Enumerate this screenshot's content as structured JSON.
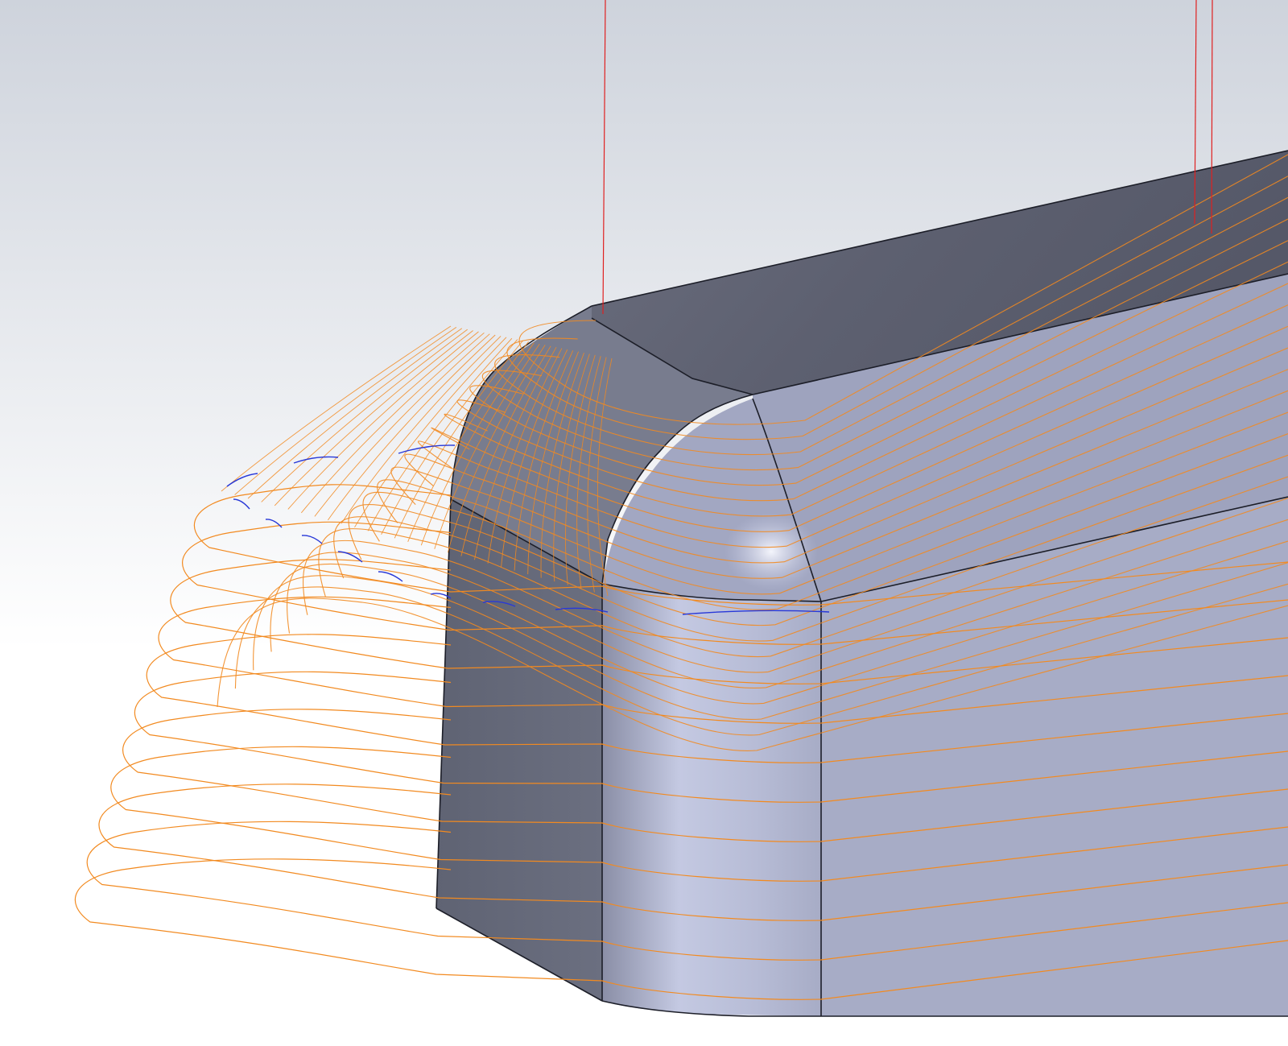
{
  "viewport": {
    "background_top": "#ced3dc",
    "background_bottom": "#ffffff",
    "view": "isometric-cad-view"
  },
  "model": {
    "part": "solid-block-with-filleted-corner",
    "face_colors": {
      "top_dark": "#5b5e6e",
      "top_mid": "#868a9a",
      "front_left": "#646878",
      "front_fillet_light": "#c6cbe2",
      "front_right": "#a6abc6",
      "corner_highlight": "#eff1fb"
    },
    "edge_color": "#1c1e28"
  },
  "toolpath": {
    "layer_color": "#f28a20",
    "stepover_color": "#f28a20",
    "retract_color": "#e02020",
    "link_color": "#2838d8",
    "offset_layer_count": 11,
    "surface_pass_count": 22
  }
}
